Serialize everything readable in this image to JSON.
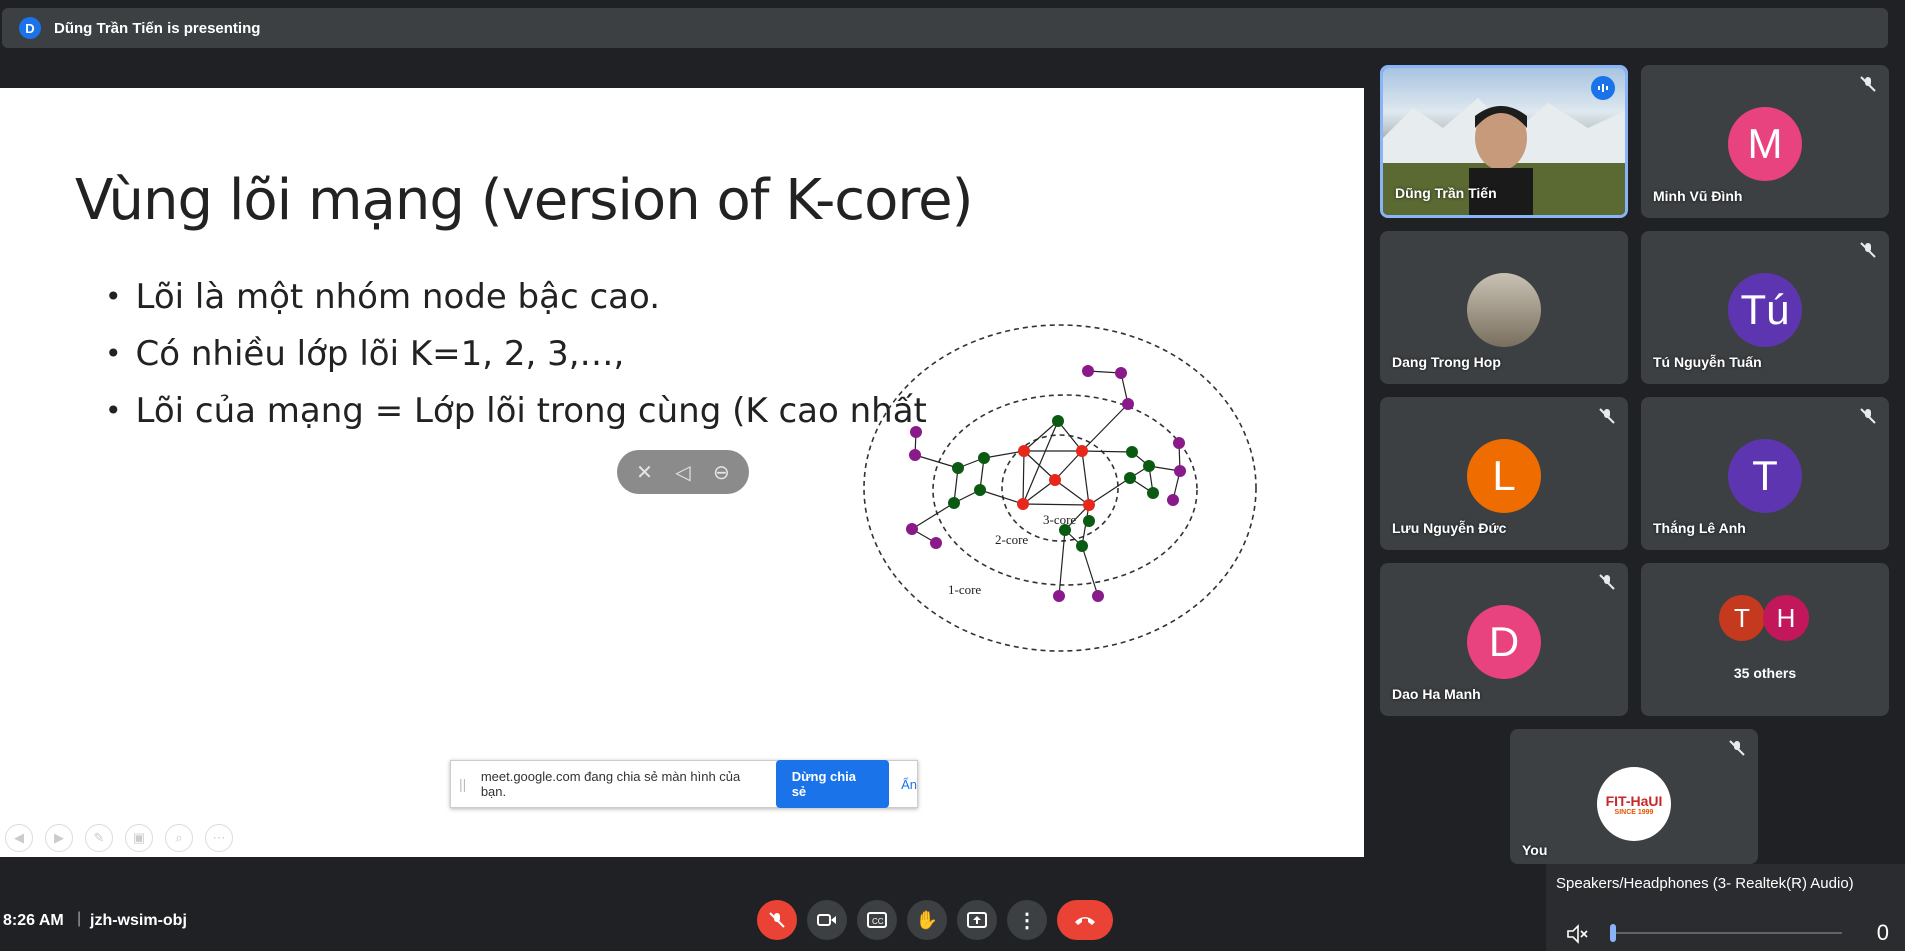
{
  "topbar": {
    "avatar_letter": "D",
    "text": "Dũng Trần Tiến is presenting"
  },
  "slide": {
    "title": "Vùng lõi mạng (version of K-core)",
    "bullets": [
      "Lõi là một nhóm node bậc cao.",
      "Có nhiều lớp lõi K=1, 2, 3,…,",
      "Lõi của mạng = Lớp lõi trong cùng (K cao nhất"
    ],
    "diagram_labels": {
      "core3": "3-core",
      "core2": "2-core",
      "core1": "1-core"
    },
    "share_bar": {
      "message": "meet.google.com đang chia sẻ màn hình của bạn.",
      "stop_label": "Dừng chia sẻ",
      "hide_label": "Ẩn"
    }
  },
  "participants": [
    {
      "name": "Dũng Trần Tiến",
      "type": "video",
      "speaking": true
    },
    {
      "name": "Minh Vũ Đình",
      "letter": "M",
      "color": "#e8437e",
      "muted": true
    },
    {
      "name": "Dang Trong Hop",
      "type": "photo",
      "muted": false
    },
    {
      "name": "Tú Nguyễn Tuấn",
      "letter": "Tú",
      "color": "#5e35b1",
      "muted": true
    },
    {
      "name": "Lưu Nguyễn Đức",
      "letter": "L",
      "color": "#ef6c00",
      "muted": true
    },
    {
      "name": "Thắng Lê Anh",
      "letter": "T",
      "color": "#5e35b1",
      "muted": true
    },
    {
      "name": "Dao Ha Manh",
      "letter": "D",
      "color": "#e8437e",
      "muted": true
    },
    {
      "name": "35 others",
      "letters": [
        "T",
        "H"
      ],
      "colors": [
        "#c5391f",
        "#c2185b"
      ]
    },
    {
      "name": "You",
      "logo_text": "FIT-HaUI",
      "logo_sub": "SINCE 1999",
      "muted": true
    }
  ],
  "bottom": {
    "time": "8:26 AM",
    "separator": "|",
    "meeting_code": "jzh-wsim-obj"
  },
  "audio": {
    "device": "Speakers/Headphones (3- Realtek(R) Audio)",
    "value": "0"
  },
  "colors": {
    "red": "#ea4335",
    "blue": "#1a73e8",
    "bg": "#202124",
    "tile": "#3c4043"
  }
}
